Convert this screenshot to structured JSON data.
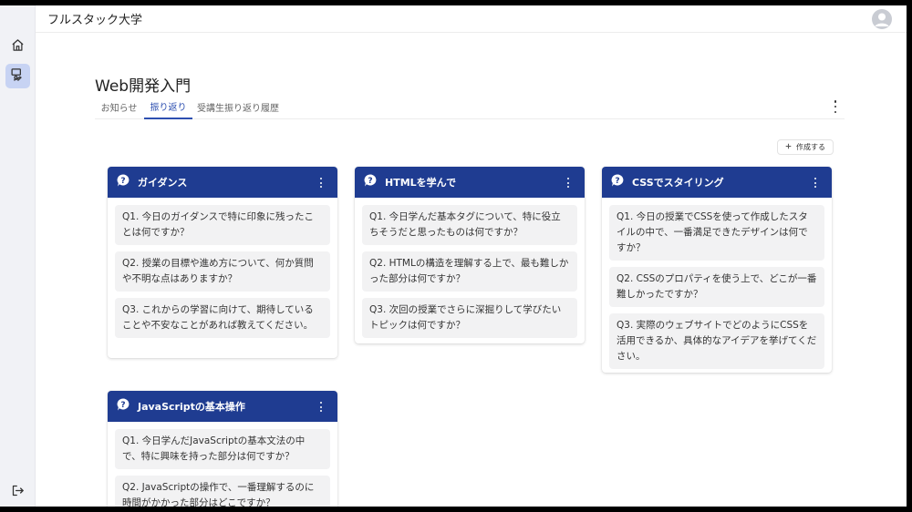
{
  "app": {
    "title": "フルスタック大学"
  },
  "sidebar": {
    "items": [
      {
        "icon": "home-icon"
      },
      {
        "icon": "reflection-icon",
        "active": true
      },
      {
        "icon": "logout-icon"
      }
    ]
  },
  "course": {
    "title": "Web開発入門"
  },
  "tabs": [
    {
      "label": "お知らせ"
    },
    {
      "label": "振り返り",
      "active": true
    },
    {
      "label": "受講生振り返り履歴"
    }
  ],
  "actions": {
    "create_label": "作成する",
    "create_icon": "plus-icon"
  },
  "colors": {
    "accent": "#1f3c91",
    "tab_active": "#2d4fb0",
    "sidebar_active": "#c7d3f3"
  },
  "cards": [
    {
      "title": "ガイダンス",
      "questions": [
        "Q1. 今日のガイダンスで特に印象に残ったことは何ですか？",
        "Q2. 授業の目標や進め方について、何か質問や不明な点はありますか？",
        "Q3. これからの学習に向けて、期待していることや不安なことがあれば教えてください。"
      ]
    },
    {
      "title": "HTMLを学んで",
      "questions": [
        "Q1. 今日学んだ基本タグについて、特に役立ちそうだと思ったものは何ですか？",
        "Q2. HTMLの構造を理解する上で、最も難しかった部分は何ですか？",
        "Q3. 次回の授業でさらに深掘りして学びたいトピックは何ですか？"
      ]
    },
    {
      "title": "CSSでスタイリング",
      "questions": [
        "Q1. 今日の授業でCSSを使って作成したスタイルの中で、一番満足できたデザインは何ですか？",
        "Q2. CSSのプロパティを使う上で、どこが一番難しかったですか？",
        "Q3. 実際のウェブサイトでどのようにCSSを活用できるか、具体的なアイデアを挙げてください。"
      ]
    },
    {
      "title": "JavaScriptの基本操作",
      "questions": [
        "Q1. 今日学んだJavaScriptの基本文法の中で、特に興味を持った部分は何ですか？",
        "Q2. JavaScriptの操作で、一番理解するのに時間がかかった部分はどこですか？"
      ]
    }
  ]
}
